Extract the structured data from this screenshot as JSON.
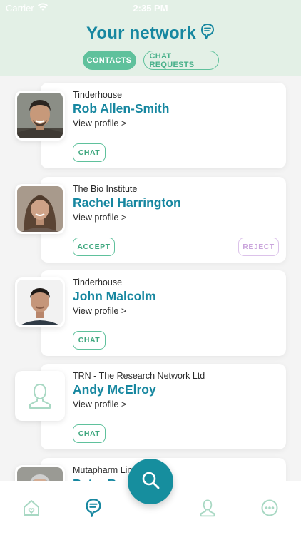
{
  "status_bar": {
    "carrier": "Carrier",
    "time": "2:35 PM"
  },
  "header": {
    "title": "Your network"
  },
  "tabs": [
    {
      "label": "CONTACTS",
      "active": true
    },
    {
      "label": "CHAT REQUESTS",
      "active": false
    }
  ],
  "contacts": [
    {
      "org": "Tinderhouse",
      "name": "Rob Allen-Smith",
      "view_label": "View profile >",
      "chat_label": "CHAT"
    },
    {
      "org": "The Bio Institute",
      "name": "Rachel Harrington",
      "view_label": "View profile >",
      "accept_label": "ACCEPT",
      "reject_label": "REJECT"
    },
    {
      "org": "Tinderhouse",
      "name": "John Malcolm",
      "view_label": "View profile >",
      "chat_label": "CHAT"
    },
    {
      "org": "TRN - The Research Network Ltd",
      "name": "Andy McElroy",
      "view_label": "View profile >",
      "chat_label": "CHAT"
    },
    {
      "org": "Mutapharm Lim",
      "name": "Peter Bus"
    }
  ],
  "colors": {
    "teal": "#1787a0",
    "green": "#5fc19c",
    "purple": "#dcc2ea",
    "header_bg": "#e3f0e6"
  }
}
